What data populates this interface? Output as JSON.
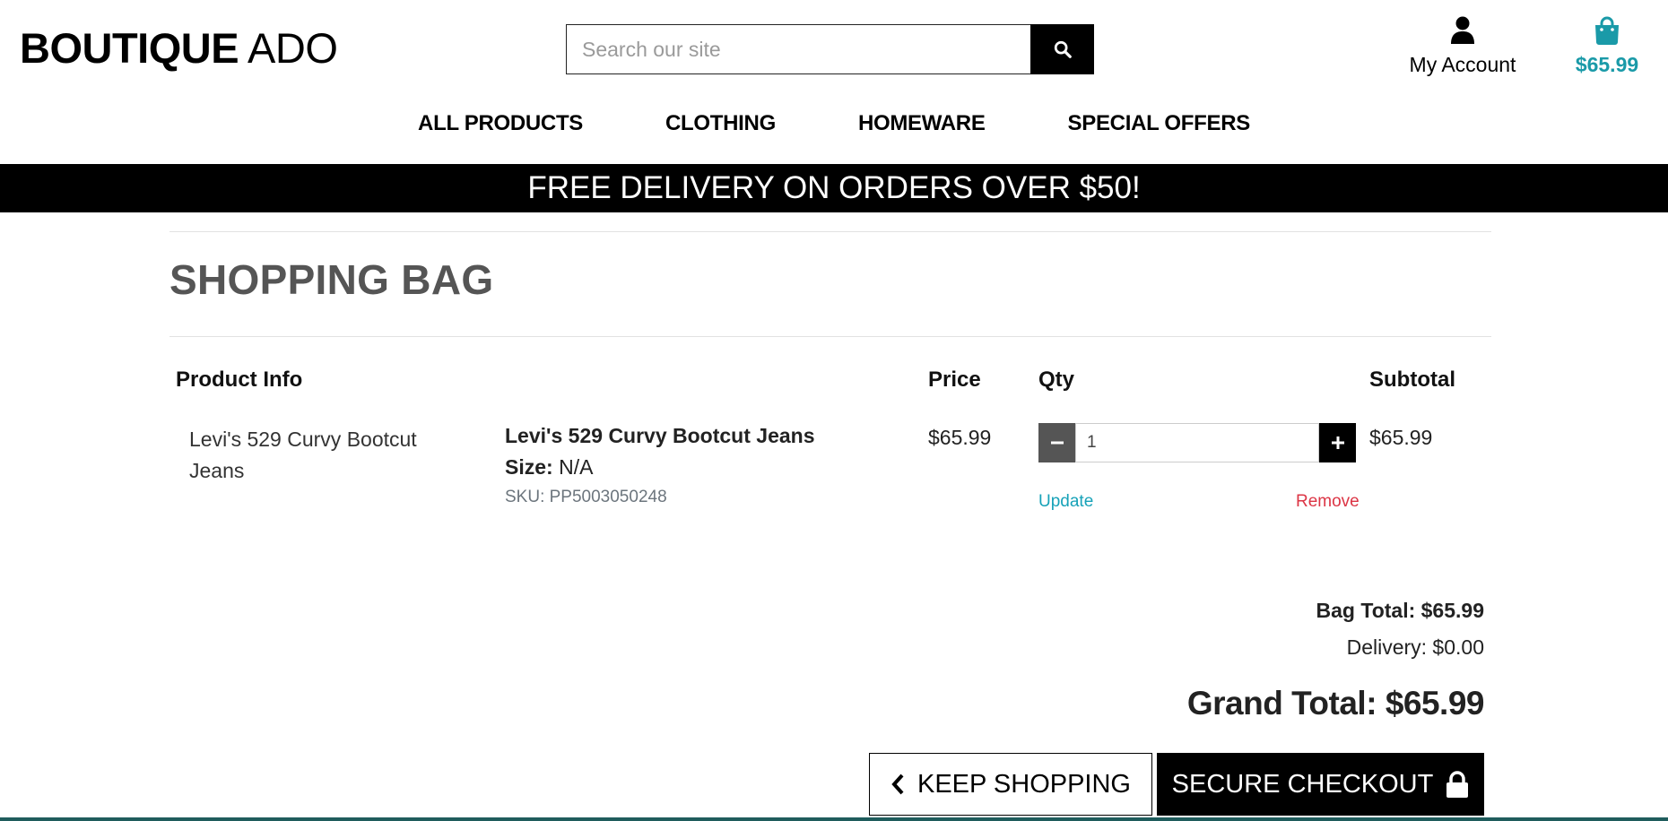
{
  "header": {
    "logo_bold": "BOUTIQUE",
    "logo_light": " ADO",
    "search_placeholder": "Search our site",
    "account_label": "My Account",
    "bag_amount": "$65.99"
  },
  "nav": {
    "items": [
      "ALL PRODUCTS",
      "CLOTHING",
      "HOMEWARE",
      "SPECIAL OFFERS"
    ]
  },
  "banner": "FREE DELIVERY ON ORDERS OVER $50!",
  "page_title": "SHOPPING BAG",
  "table": {
    "headers": {
      "product_info": "Product Info",
      "price": "Price",
      "qty": "Qty",
      "subtotal": "Subtotal"
    },
    "rows": [
      {
        "image_alt": "Levi's 529 Curvy Bootcut Jeans",
        "name": "Levi's 529 Curvy Bootcut Jeans",
        "size_label": "Size:",
        "size_value": " N/A",
        "sku": "SKU: PP5003050248",
        "price": "$65.99",
        "qty": "1",
        "update_label": "Update",
        "remove_label": "Remove",
        "subtotal": "$65.99"
      }
    ]
  },
  "totals": {
    "bag_total": "Bag Total: $65.99",
    "delivery": "Delivery: $0.00",
    "grand_total": "Grand Total: $65.99"
  },
  "actions": {
    "keep_shopping": "KEEP SHOPPING",
    "checkout": "SECURE CHECKOUT"
  },
  "colors": {
    "accent": "#1a9aa8",
    "update": "#17a2b8",
    "remove": "#dc3545",
    "banner_bg": "#000000",
    "footer_line": "#1f5c5c"
  },
  "icons": {
    "search": "search-icon",
    "account": "user-icon",
    "bag": "shopping-bag-icon",
    "minus": "minus-icon",
    "plus": "plus-icon",
    "back": "chevron-left-icon",
    "lock": "lock-icon"
  }
}
